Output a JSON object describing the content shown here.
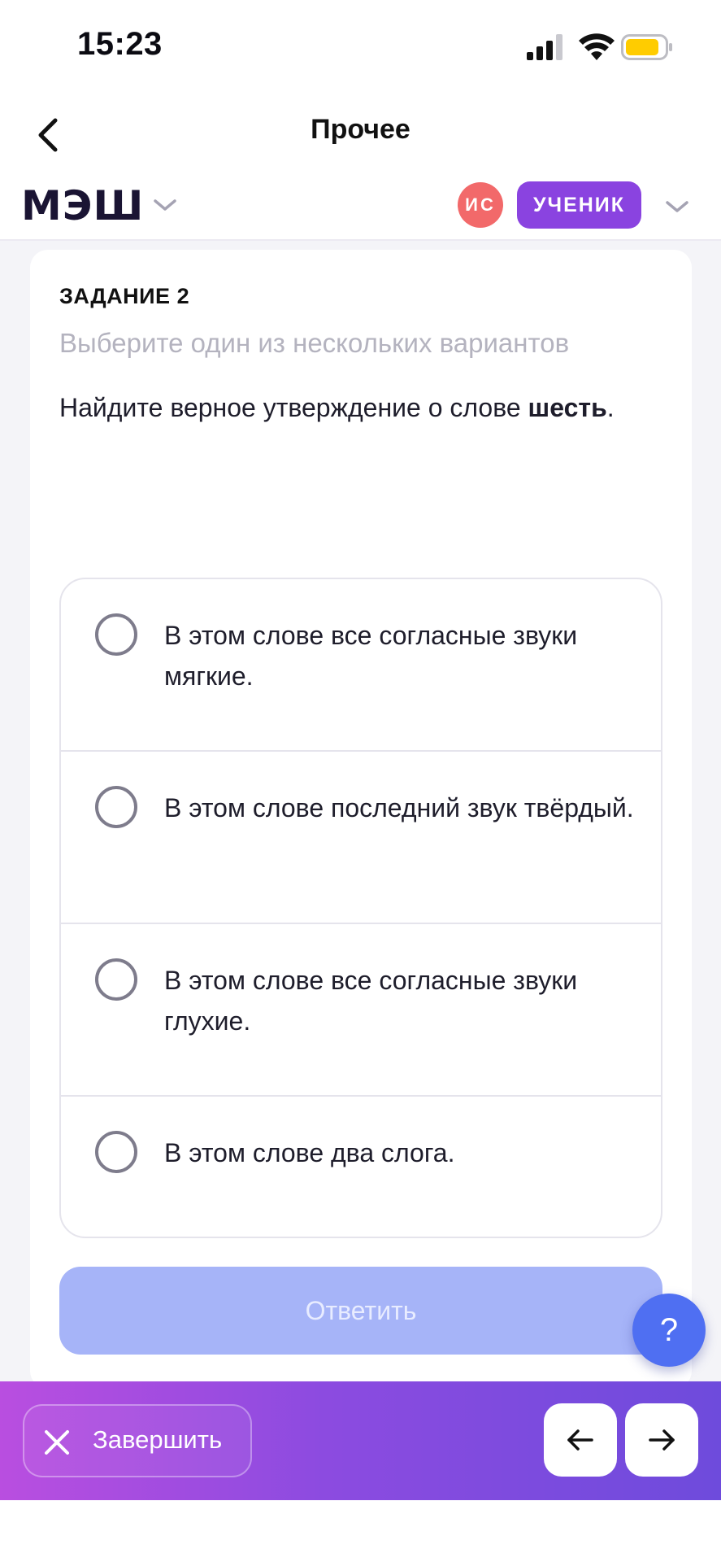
{
  "status_bar": {
    "time": "15:23"
  },
  "nav": {
    "title": "Прочее"
  },
  "header": {
    "logo": "МЭШ",
    "avatar_initials": "ИС",
    "role": "УЧЕНИК"
  },
  "task": {
    "title": "ЗАДАНИЕ 2",
    "hint": "Выберите один из нескольких вариантов",
    "question_prefix": "Найдите верное утверждение о слове ",
    "question_word": "шесть",
    "question_suffix": ".",
    "options": [
      {
        "label": "В этом слове все согласные звуки мягкие.",
        "selected": false
      },
      {
        "label": "В этом слове последний звук твёрдый.",
        "selected": false
      },
      {
        "label": "В этом слове все согласные звуки глухие.",
        "selected": false
      },
      {
        "label": "В этом слове два слога.",
        "selected": false
      }
    ],
    "answer_button": "Ответить"
  },
  "help": {
    "label": "?"
  },
  "bottom_bar": {
    "finish_label": "Завершить"
  },
  "icons": {
    "back": "chevron-left-icon",
    "dropdown": "chevron-down-icon",
    "close": "close-icon",
    "prev": "arrow-left-icon",
    "next": "arrow-right-icon"
  },
  "colors": {
    "accent": "#8a43e0",
    "avatar": "#f2696a",
    "answer_button_disabled": "#a6b4f8",
    "help_button": "#4f6ff2",
    "battery": "#ffcc00"
  }
}
